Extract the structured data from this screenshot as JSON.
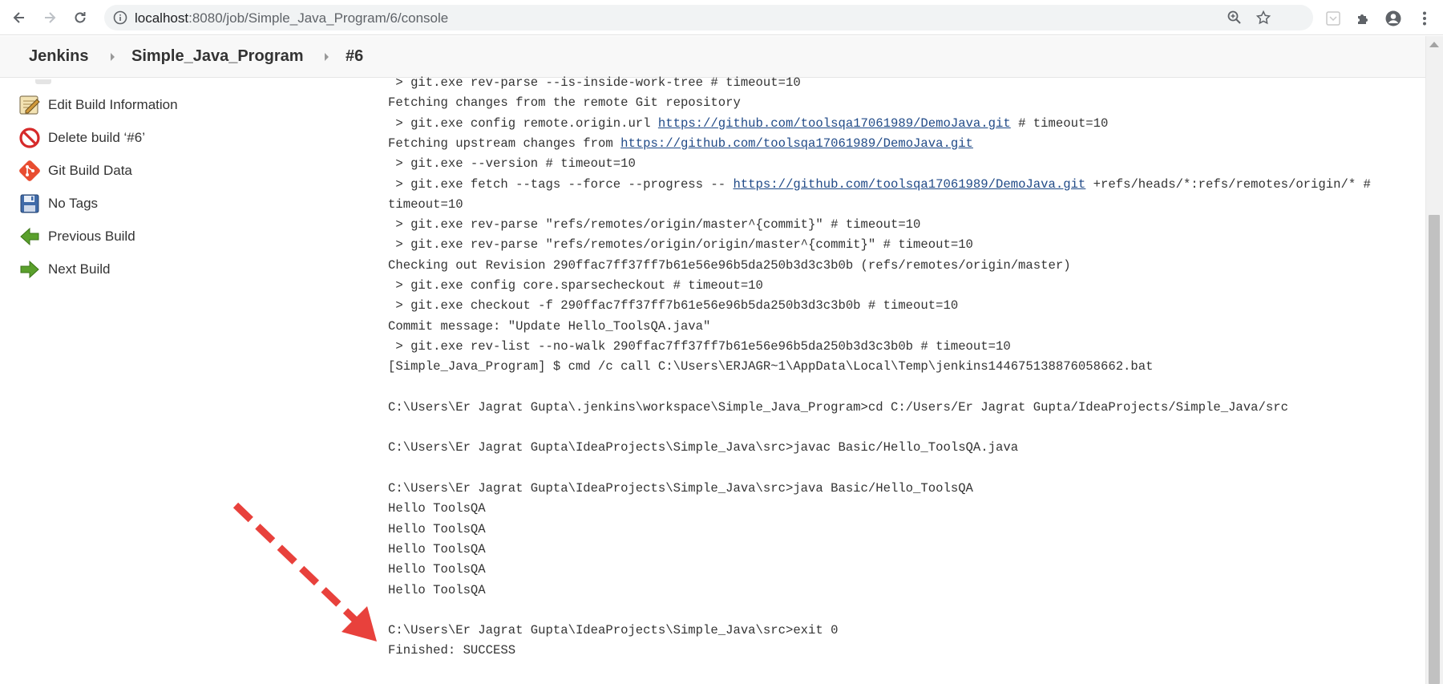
{
  "browser": {
    "url_host": "localhost",
    "url_path": ":8080/job/Simple_Java_Program/6/console"
  },
  "breadcrumb": {
    "items": [
      "Jenkins",
      "Simple_Java_Program",
      "#6"
    ]
  },
  "sidebar": {
    "items": [
      {
        "label": "Edit Build Information",
        "icon": "notepad-pencil-icon"
      },
      {
        "label": "Delete build ‘#6’",
        "icon": "no-entry-icon"
      },
      {
        "label": "Git Build Data",
        "icon": "git-logo-icon"
      },
      {
        "label": "No Tags",
        "icon": "floppy-disk-icon"
      },
      {
        "label": "Previous Build",
        "icon": "green-left-arrow-icon"
      },
      {
        "label": "Next Build",
        "icon": "green-right-arrow-icon"
      }
    ]
  },
  "console": {
    "l01": " > git.exe rev-parse --is-inside-work-tree # timeout=10",
    "l02": "Fetching changes from the remote Git repository",
    "l03a": " > git.exe config remote.origin.url ",
    "l03link": "https://github.com/toolsqa17061989/DemoJava.git",
    "l03b": " # timeout=10",
    "l04a": "Fetching upstream changes from ",
    "l04link": "https://github.com/toolsqa17061989/DemoJava.git",
    "l05": " > git.exe --version # timeout=10",
    "l06a": " > git.exe fetch --tags --force --progress -- ",
    "l06link": "https://github.com/toolsqa17061989/DemoJava.git",
    "l06b": " +refs/heads/*:refs/remotes/origin/* #",
    "l07": "timeout=10",
    "l08": " > git.exe rev-parse \"refs/remotes/origin/master^{commit}\" # timeout=10",
    "l09": " > git.exe rev-parse \"refs/remotes/origin/origin/master^{commit}\" # timeout=10",
    "l10": "Checking out Revision 290ffac7ff37ff7b61e56e96b5da250b3d3c3b0b (refs/remotes/origin/master)",
    "l11": " > git.exe config core.sparsecheckout # timeout=10",
    "l12": " > git.exe checkout -f 290ffac7ff37ff7b61e56e96b5da250b3d3c3b0b # timeout=10",
    "l13": "Commit message: \"Update Hello_ToolsQA.java\"",
    "l14": " > git.exe rev-list --no-walk 290ffac7ff37ff7b61e56e96b5da250b3d3c3b0b # timeout=10",
    "l15": "[Simple_Java_Program] $ cmd /c call C:\\Users\\ERJAGR~1\\AppData\\Local\\Temp\\jenkins144675138876058662.bat",
    "l17": "C:\\Users\\Er Jagrat Gupta\\.jenkins\\workspace\\Simple_Java_Program>cd C:/Users/Er Jagrat Gupta/IdeaProjects/Simple_Java/src",
    "l19": "C:\\Users\\Er Jagrat Gupta\\IdeaProjects\\Simple_Java\\src>javac Basic/Hello_ToolsQA.java",
    "l21": "C:\\Users\\Er Jagrat Gupta\\IdeaProjects\\Simple_Java\\src>java Basic/Hello_ToolsQA",
    "hello": "Hello ToolsQA",
    "l28": "C:\\Users\\Er Jagrat Gupta\\IdeaProjects\\Simple_Java\\src>exit 0",
    "l29": "Finished: SUCCESS"
  },
  "colors": {
    "link": "#204a87",
    "annotation_arrow": "#e8413c",
    "nav_arrow_green": "#5aa02c"
  }
}
